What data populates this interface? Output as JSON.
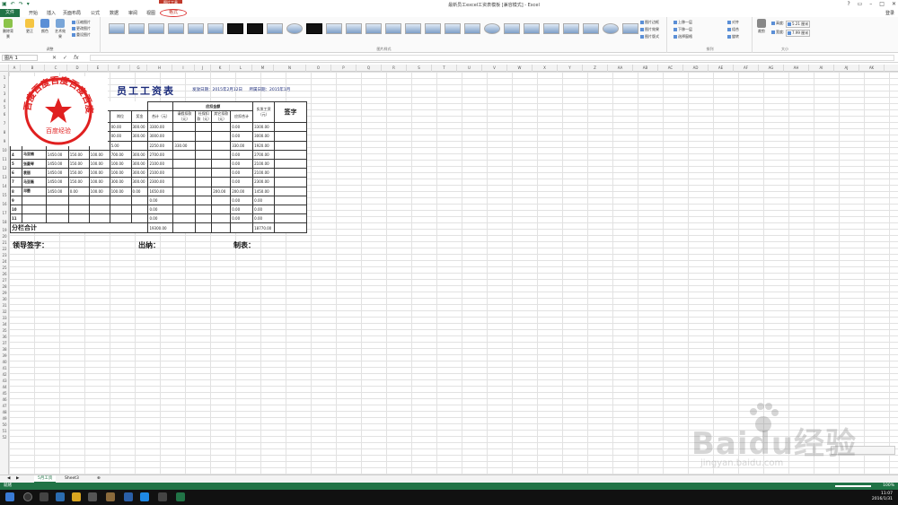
{
  "titlebar": {
    "window_title": "最新员工excel工资表模板 [兼容模式] - Excel",
    "context_tab": "图片工具",
    "login": "登录"
  },
  "tabs": [
    "文件",
    "开始",
    "插入",
    "页面布局",
    "公式",
    "数据",
    "审阅",
    "视图"
  ],
  "format_tab": "格式",
  "ribbon": {
    "adjust": {
      "remove_bg": "删除背景",
      "correct": "更正",
      "color": "颜色",
      "artistic": "艺术效果",
      "compress": "压缩图片",
      "change": "更改图片",
      "reset": "重设图片",
      "label": "调整"
    },
    "styles_label": "图片样式",
    "styles_right": [
      "图片边框",
      "图片效果",
      "图片版式"
    ],
    "arrange": [
      "上移一层",
      "下移一层",
      "选择窗格",
      "对齐",
      "组合",
      "旋转"
    ],
    "arrange_label": "排列",
    "size": {
      "crop": "裁剪",
      "height_label": "高度:",
      "height_value": "5.21 厘米",
      "width_label": "宽度:",
      "width_value": "7.99 厘米",
      "label": "大小"
    }
  },
  "formulabar": {
    "namebox": "图片 1",
    "fx": "fx"
  },
  "columns": [
    "A",
    "B",
    "C",
    "D",
    "E",
    "F",
    "G",
    "H",
    "I",
    "J",
    "K",
    "L",
    "M",
    "N",
    "O",
    "P",
    "Q",
    "R",
    "S",
    "T",
    "U",
    "V",
    "W",
    "X",
    "Y",
    "Z",
    "AA",
    "AB",
    "AC",
    "AD",
    "AE",
    "AF",
    "AG",
    "AH",
    "AI",
    "AJ",
    "AK"
  ],
  "sheet": {
    "title": "员工工资表",
    "date_make": "发放日期：2015年2月12日",
    "date_year": "所属日期：2015年1月",
    "header": {
      "attendance": "应扣金额",
      "position_pay": "岗位",
      "bonus": "奖金",
      "total": "合计（元）",
      "absent": "请假扣款（元）",
      "social": "社保扣款（元）",
      "other": "其它扣款（元）",
      "deduct_total": "应扣合计",
      "actual": "实发工资（元）",
      "signature": "签字"
    },
    "rows": [
      {
        "no": "",
        "name": "",
        "base": "",
        "a": "",
        "b": "",
        "pos": "00.00",
        "bonus": "300.00",
        "total": "3300.00",
        "absent": "",
        "social": "",
        "other": "",
        "ded": "0.00",
        "actual": "3300.00"
      },
      {
        "no": "",
        "name": "",
        "base": "",
        "a": "",
        "b": "",
        "pos": "00.00",
        "bonus": "300.00",
        "total": "3000.00",
        "absent": "",
        "social": "",
        "other": "",
        "ded": "0.00",
        "actual": "3000.00"
      },
      {
        "no": "",
        "name": "",
        "base": "",
        "a": "",
        "b": "",
        "pos": "5.00",
        "bonus": "",
        "total": "2250.00",
        "absent": "330.00",
        "social": "",
        "other": "",
        "ded": "330.00",
        "actual": "1920.00"
      },
      {
        "no": "4",
        "name": "马亚楠",
        "base": "1450.00",
        "a": "150.00",
        "b": "100.00",
        "pos": "700.00",
        "bonus": "300.00",
        "total": "2700.00",
        "absent": "",
        "social": "",
        "other": "",
        "ded": "0.00",
        "actual": "2700.00"
      },
      {
        "no": "5",
        "name": "张曼琴",
        "base": "1450.00",
        "a": "150.00",
        "b": "100.00",
        "pos": "100.00",
        "bonus": "300.00",
        "total": "2100.00",
        "absent": "",
        "social": "",
        "other": "",
        "ded": "0.00",
        "actual": "2100.00"
      },
      {
        "no": "6",
        "name": "袁丽",
        "base": "1450.00",
        "a": "150.00",
        "b": "100.00",
        "pos": "100.00",
        "bonus": "300.00",
        "total": "2100.00",
        "absent": "",
        "social": "",
        "other": "",
        "ded": "0.00",
        "actual": "2100.00"
      },
      {
        "no": "7",
        "name": "马亚磊",
        "base": "1450.00",
        "a": "150.00",
        "b": "100.00",
        "pos": "300.00",
        "bonus": "300.00",
        "total": "2300.00",
        "absent": "",
        "social": "",
        "other": "",
        "ded": "0.00",
        "actual": "2300.00"
      },
      {
        "no": "8",
        "name": "邓蕾",
        "base": "1450.00",
        "a": "0.00",
        "b": "100.00",
        "pos": "100.00",
        "bonus": "0.00",
        "total": "1650.00",
        "absent": "",
        "social": "",
        "other": "200.00",
        "ded": "200.00",
        "actual": "1450.00"
      },
      {
        "no": "9",
        "name": "",
        "base": "",
        "a": "",
        "b": "",
        "pos": "",
        "bonus": "",
        "total": "0.00",
        "absent": "",
        "social": "",
        "other": "",
        "ded": "0.00",
        "actual": "0.00"
      },
      {
        "no": "10",
        "name": "",
        "base": "",
        "a": "",
        "b": "",
        "pos": "",
        "bonus": "",
        "total": "0.00",
        "absent": "",
        "social": "",
        "other": "",
        "ded": "0.00",
        "actual": "0.00"
      },
      {
        "no": "11",
        "name": "",
        "base": "",
        "a": "",
        "b": "",
        "pos": "",
        "bonus": "",
        "total": "0.00",
        "absent": "",
        "social": "",
        "other": "",
        "ded": "0.00",
        "actual": "0.00"
      }
    ],
    "subtotal": {
      "label": "分栏合计",
      "total": "19300.00",
      "actual": "18770.00"
    },
    "footer": {
      "leader": "领导签字：",
      "cashier": "出纳：",
      "maker": "制表："
    }
  },
  "stamp": {
    "ring_text": "百度百度百度百度百度",
    "center_text": "百度经验",
    "color": "#e02020"
  },
  "sheettabs": [
    "5月工资",
    "Sheet3"
  ],
  "status": {
    "left": "就绪",
    "zoom": "100%"
  },
  "clock": {
    "time": "11:07",
    "date": "2016/1/31"
  },
  "watermark": {
    "brand": "Baidu经验",
    "url": "jingyan.baidu.com"
  },
  "colors": {
    "excel_green": "#217346",
    "title_blue": "#1a2a7a",
    "context_red": "#c0392b"
  }
}
